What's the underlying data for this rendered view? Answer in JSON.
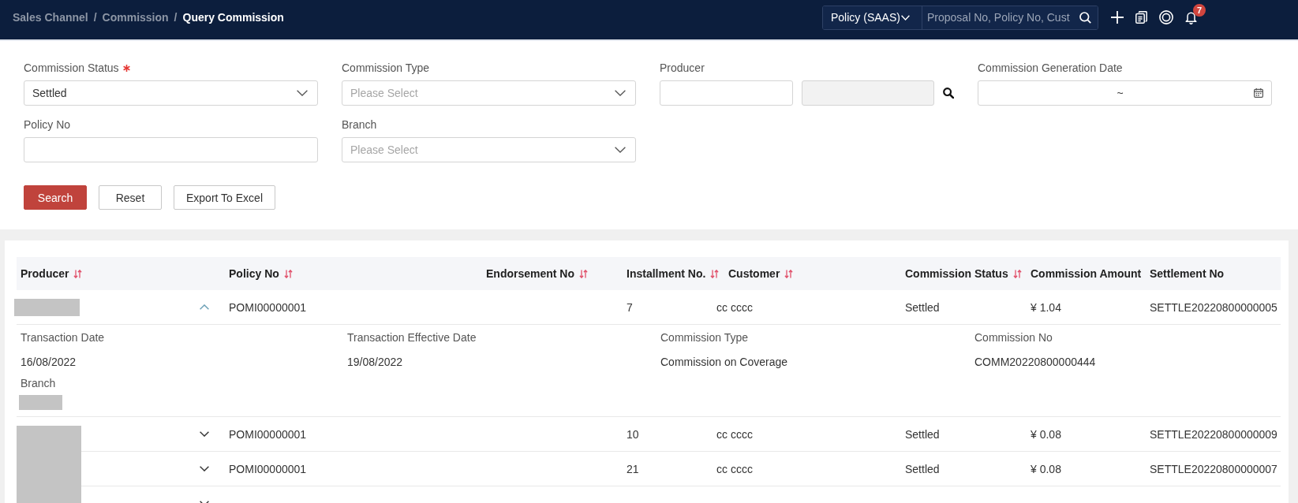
{
  "top_bar": {
    "breadcrumb": [
      {
        "label": "Sales Channel",
        "current": false,
        "separator": "/"
      },
      {
        "label": "Commission",
        "current": false,
        "separator": "/"
      },
      {
        "label": "Query Commission",
        "current": true
      }
    ],
    "search": {
      "scope": "Policy (SAAS)",
      "placeholder": "Proposal No, Policy No, Cust"
    },
    "notifications": {
      "count": "7"
    }
  },
  "filters": [
    {
      "kind": "select",
      "label": "Commission Status",
      "required": true,
      "value": "Settled"
    },
    {
      "kind": "select",
      "label": "Commission Type",
      "required": false,
      "placeholder": "Please Select"
    },
    {
      "kind": "lookup",
      "label": "Producer",
      "required": false,
      "name_disabled": true
    },
    {
      "kind": "daterange",
      "label": "Commission Generation Date",
      "required": false,
      "separator": "~"
    },
    {
      "kind": "text",
      "label": "Policy No",
      "required": false
    },
    {
      "kind": "select",
      "label": "Branch",
      "required": false,
      "placeholder": "Please Select"
    }
  ],
  "actions": [
    {
      "kind": "primary",
      "label": "Search"
    },
    {
      "kind": "default",
      "label": "Reset"
    },
    {
      "kind": "default",
      "label": "Export To Excel"
    }
  ],
  "table": {
    "columns": [
      {
        "label": "Producer",
        "sortable": true
      },
      {
        "label": "Policy No",
        "sortable": true
      },
      {
        "label": "Endorsement No",
        "sortable": true
      },
      {
        "label": "Installment No.",
        "sortable": true
      },
      {
        "label": "Customer",
        "sortable": true
      },
      {
        "label": "Commission Status",
        "sortable": true
      },
      {
        "label": "Commission Amount",
        "sortable": false
      },
      {
        "label": "Settlement No",
        "sortable": false
      }
    ],
    "rows": [
      {
        "expanded": true,
        "producer_redacted": true,
        "policy_no": "POMI00000001",
        "installment_no": "7",
        "customer": "cc cccc",
        "status": "Settled",
        "amount": "¥ 1.04",
        "settlement_no": "SETTLE20220800000005",
        "details": [
          {
            "label": "Transaction Date",
            "value": "16/08/2022"
          },
          {
            "label": "Transaction Effective Date",
            "value": "19/08/2022"
          },
          {
            "label": "Commission Type",
            "value": "Commission on Coverage"
          },
          {
            "label": "Commission No",
            "value": "COMM20220800000444"
          },
          {
            "label": "Branch",
            "value_redacted": true
          }
        ]
      },
      {
        "expanded": false,
        "producer_redacted": true,
        "policy_no": "POMI00000001",
        "installment_no": "10",
        "customer": "cc cccc",
        "status": "Settled",
        "amount": "¥ 0.08",
        "settlement_no": "SETTLE20220800000009"
      },
      {
        "expanded": false,
        "producer_redacted": true,
        "policy_no": "POMI00000001",
        "installment_no": "21",
        "customer": "cc cccc",
        "status": "Settled",
        "amount": "¥ 0.08",
        "settlement_no": "SETTLE20220800000007"
      },
      {
        "expanded": false,
        "producer_redacted": true
      }
    ]
  }
}
